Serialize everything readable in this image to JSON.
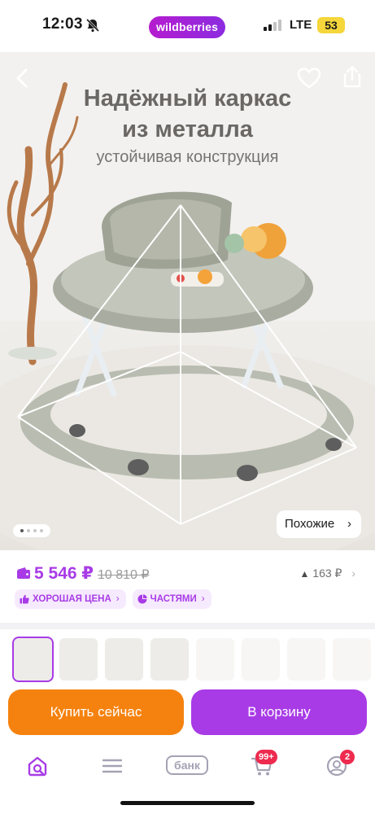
{
  "status_bar": {
    "time": "12:03",
    "brand_pill": "wildberries",
    "network": "LTE",
    "battery": "53"
  },
  "hero": {
    "title": "Надёжный каркас\nиз металла",
    "subtitle": "устойчивая конструкция",
    "similar_button": "Похожие",
    "image_count": 4,
    "active_image": 1
  },
  "price": {
    "current": "5 546 ₽",
    "old": "10 810 ₽",
    "change": "163 ₽"
  },
  "tags": [
    {
      "label": "ХОРОШАЯ ЦЕНА",
      "icon": "thumbs-up-icon"
    },
    {
      "label": "ЧАСТЯМИ",
      "icon": "pie-chart-icon"
    }
  ],
  "thumbnails": {
    "count": 8,
    "active_index": 0,
    "faded_from": 4
  },
  "actions": {
    "buy_now": "Купить сейчас",
    "add_to_cart": "В корзину"
  },
  "bottom_nav": {
    "items": [
      {
        "name": "home-search-icon",
        "active": true
      },
      {
        "name": "catalog-menu-icon"
      },
      {
        "name": "bank-label",
        "label": "банк"
      },
      {
        "name": "cart-icon",
        "badge": "99+"
      },
      {
        "name": "profile-icon",
        "badge": "2"
      }
    ]
  },
  "colors": {
    "accent": "#a83be6",
    "buy_now": "#f5820f",
    "badge": "#ee2a4f"
  }
}
